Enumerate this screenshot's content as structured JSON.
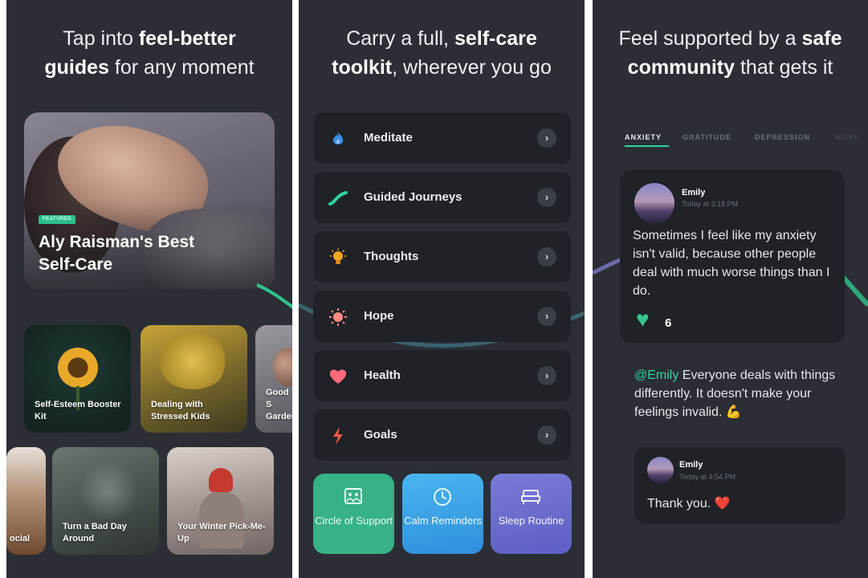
{
  "screens": [
    {
      "headline_plain_1": "Tap into ",
      "headline_bold_1": "feel-better",
      "headline_bold_2": "guides",
      "headline_plain_2": " for any moment",
      "hero": {
        "badge": "FEATURED",
        "title": "Aly Raisman's Best Self-Care"
      },
      "cards": [
        {
          "label": "Self-Esteem Booster Kit"
        },
        {
          "label": "Dealing with Stressed Kids"
        },
        {
          "label": "Good S Garden"
        },
        {
          "label": "ocial"
        },
        {
          "label": "Turn a Bad Day Around"
        },
        {
          "label": "Your Winter Pick-Me-Up"
        }
      ]
    },
    {
      "headline_plain_1": "Carry a full, ",
      "headline_bold_1": "self-care",
      "headline_bold_2": "toolkit",
      "headline_plain_2": ", wherever you go",
      "menu": [
        {
          "label": "Meditate",
          "icon": "flame-icon",
          "color": "#3a8fe8"
        },
        {
          "label": "Guided Journeys",
          "icon": "path-icon",
          "color": "#2fd6a0"
        },
        {
          "label": "Thoughts",
          "icon": "lightbulb-icon",
          "color": "#f5a623"
        },
        {
          "label": "Hope",
          "icon": "sun-icon",
          "color": "#ff8a80"
        },
        {
          "label": "Health",
          "icon": "heart-icon",
          "color": "#ff6b7a"
        },
        {
          "label": "Goals",
          "icon": "lightning-icon",
          "color": "#ff5a4a"
        }
      ],
      "chevron": "›",
      "tiles": [
        {
          "label": "Circle of Support",
          "icon": "photo-frame-icon"
        },
        {
          "label": "Calm Reminders",
          "icon": "clock-icon"
        },
        {
          "label": "Sleep Routine",
          "icon": "bed-icon"
        }
      ]
    },
    {
      "headline_plain_1": "Feel supported by a ",
      "headline_bold_1": "safe",
      "headline_bold_2": "community",
      "headline_plain_2": " that gets it",
      "tabs": [
        "ANXIETY",
        "GRATITUDE",
        "DEPRESSION",
        "MOVE"
      ],
      "post": {
        "user": "Emily",
        "time": "Today at 3:18 PM",
        "text": "Sometimes I feel like my anxiety isn't valid, because other people deal with much worse things than I do.",
        "likes": "6"
      },
      "reply": {
        "mention": "@Emily",
        "text": " Everyone deals with things differently. It doesn't make your feelings invalid. 💪"
      },
      "reply2": {
        "user": "Emily",
        "time": "Today at 4:54 PM",
        "text": "Thank you. ❤️"
      }
    }
  ]
}
